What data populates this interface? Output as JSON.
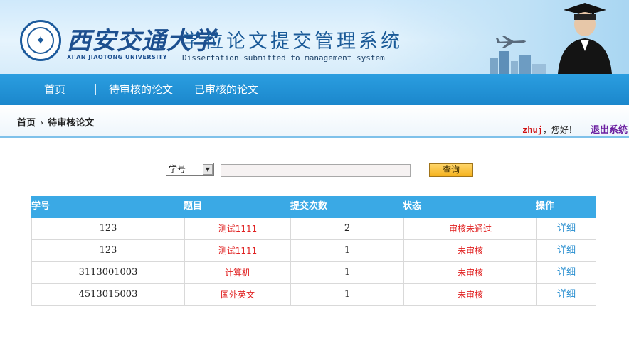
{
  "header": {
    "university_cn": "西安交通大学",
    "university_en": "XI'AN JIAOTONG UNIVERSITY",
    "system_cn": "学位论文提交管理系统",
    "system_en": "Dissertation submitted to management system"
  },
  "nav": {
    "items": [
      {
        "label": "首页"
      },
      {
        "label": "待审核的论文"
      },
      {
        "label": "已审核的论文"
      }
    ]
  },
  "breadcrumb": {
    "home": "首页",
    "arrow": "›",
    "current": "待审核论文"
  },
  "user": {
    "name": "zhuj",
    "greeting": "，您好！",
    "logout_label": "退出系统"
  },
  "search": {
    "field_selected": "学号",
    "input_value": "",
    "button_label": "查询"
  },
  "table": {
    "columns": [
      "学号",
      "题目",
      "提交次数",
      "状态",
      "操作"
    ],
    "rows": [
      {
        "id": "123",
        "title": "测试1111",
        "count": "2",
        "status": "审核未通过",
        "action": "详细"
      },
      {
        "id": "123",
        "title": "测试1111",
        "count": "1",
        "status": "未审核",
        "action": "详细"
      },
      {
        "id": "3113001003",
        "title": "计算机",
        "count": "1",
        "status": "未审核",
        "action": "详细"
      },
      {
        "id": "4513015003",
        "title": "国外英文",
        "count": "1",
        "status": "未审核",
        "action": "详细"
      }
    ]
  },
  "colors": {
    "nav_blue": "#1b87cc",
    "table_header": "#3aa9e5",
    "status_red": "#e02020",
    "link_blue": "#2a8fd0"
  }
}
